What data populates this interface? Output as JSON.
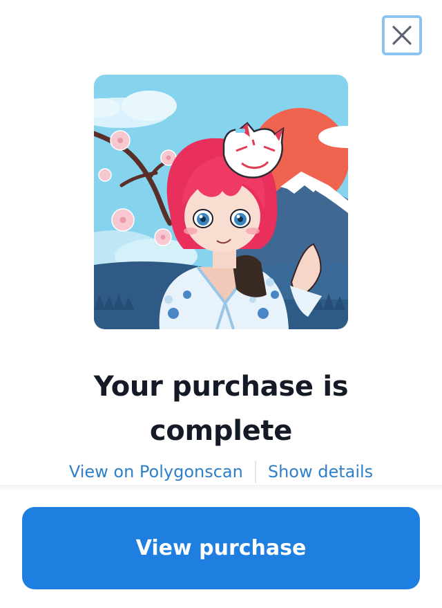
{
  "dialog": {
    "close_icon": "close-icon",
    "image_alt": "Anime-style character with pink hair, fox mask, blue kimono, in front of Mount Fuji and cherry blossoms",
    "title": "Your purchase is complete",
    "links": {
      "explorer": "View on Polygonscan",
      "details": "Show details"
    },
    "primary_button": "View purchase"
  },
  "colors": {
    "accent": "#1f7fe0",
    "link": "#2f7fc9",
    "title": "#141a26",
    "close_border": "#8cc2ef"
  }
}
